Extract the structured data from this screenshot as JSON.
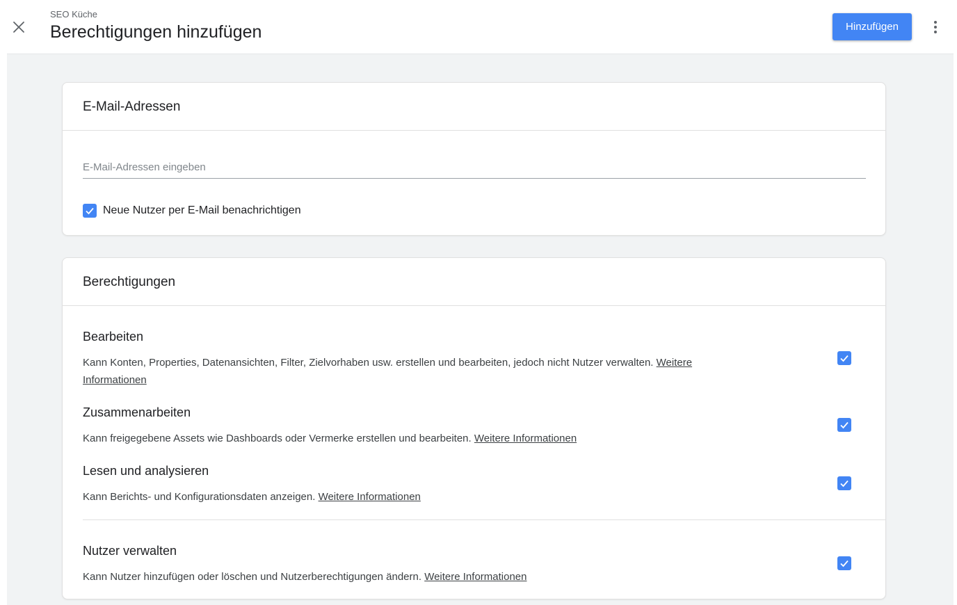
{
  "header": {
    "subtitle": "SEO Küche",
    "title": "Berechtigungen hinzufügen",
    "add_button": "Hinzufügen"
  },
  "email_card": {
    "title": "E-Mail-Adressen",
    "input_placeholder": "E-Mail-Adressen eingeben",
    "input_value": "",
    "notify_label": "Neue Nutzer per E-Mail benachrichtigen",
    "notify_checked": true
  },
  "permissions_card": {
    "title": "Berechtigungen",
    "items": [
      {
        "title": "Bearbeiten",
        "description": "Kann Konten, Properties, Datenansichten, Filter, Zielvorhaben usw. erstellen und bearbeiten, jedoch nicht Nutzer verwalten.",
        "link": "Weitere Informationen",
        "checked": true
      },
      {
        "title": "Zusammenarbeiten",
        "description": "Kann freigegebene Assets wie Dashboards oder Vermerke erstellen und bearbeiten.",
        "link": "Weitere Informationen",
        "checked": true
      },
      {
        "title": "Lesen und analysieren",
        "description": "Kann Berichts- und Konfigurationsdaten anzeigen.",
        "link": "Weitere Informationen",
        "checked": true
      },
      {
        "title": "Nutzer verwalten",
        "description": "Kann Nutzer hinzufügen oder löschen und Nutzerberechtigungen ändern.",
        "link": "Weitere Informationen",
        "checked": true
      }
    ]
  },
  "icons": {
    "close": "close-icon",
    "more": "more-vert-icon",
    "check": "checkmark-icon"
  },
  "colors": {
    "accent": "#4285f4",
    "background": "#f1f3f4"
  }
}
